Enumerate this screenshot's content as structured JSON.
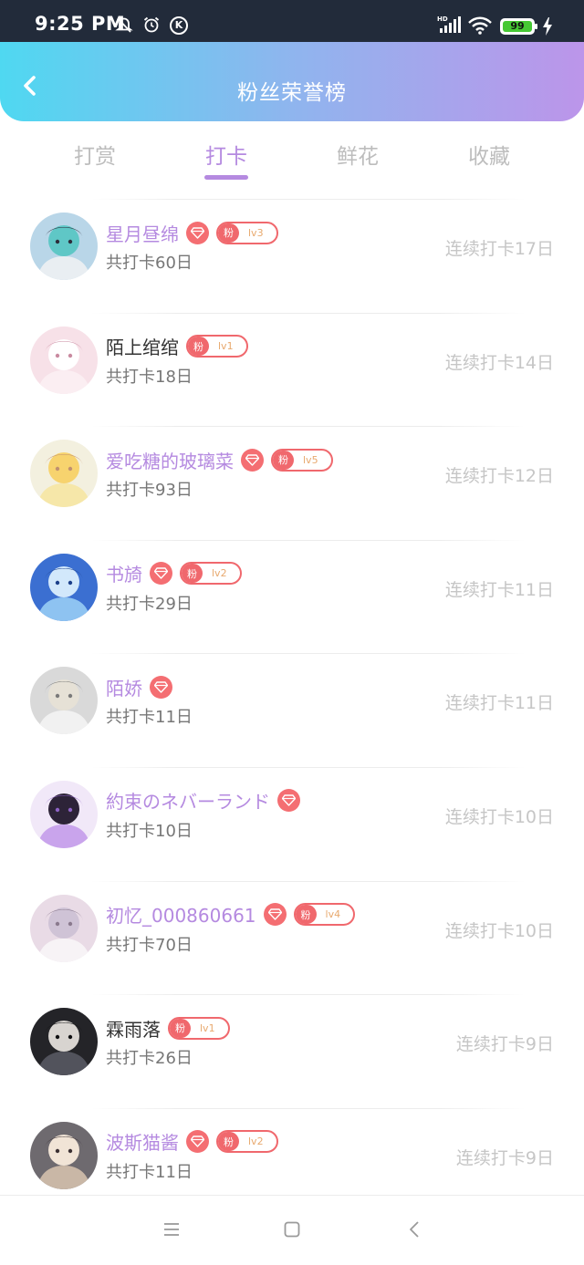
{
  "status_bar": {
    "time": "9:25 PM",
    "k_badge": "K",
    "network": "HD",
    "battery": "99"
  },
  "header": {
    "title": "粉丝荣誉榜",
    "back_icon": "chevron-left-icon"
  },
  "tabs": [
    {
      "label": "打赏",
      "active": false
    },
    {
      "label": "打卡",
      "active": true
    },
    {
      "label": "鲜花",
      "active": false
    },
    {
      "label": "收藏",
      "active": false
    }
  ],
  "badge_tag": "粉",
  "fans": [
    {
      "name": "星月昼绵",
      "name_style": "vip",
      "diamond": true,
      "level": "lv3",
      "total": "共打卡60日",
      "streak": "连续打卡17日"
    },
    {
      "name": "陌上绾绾",
      "name_style": "plain",
      "diamond": false,
      "level": "lv1",
      "total": "共打卡18日",
      "streak": "连续打卡14日"
    },
    {
      "name": "爱吃糖的玻璃菜",
      "name_style": "vip",
      "diamond": true,
      "level": "lv5",
      "total": "共打卡93日",
      "streak": "连续打卡12日"
    },
    {
      "name": "书旑",
      "name_style": "vip",
      "diamond": true,
      "level": "lv2",
      "total": "共打卡29日",
      "streak": "连续打卡11日"
    },
    {
      "name": "陌娇",
      "name_style": "vip",
      "diamond": true,
      "level": "",
      "total": "共打卡11日",
      "streak": "连续打卡11日"
    },
    {
      "name": "約束のネバーランド",
      "name_style": "vip",
      "diamond": true,
      "level": "",
      "total": "共打卡10日",
      "streak": "连续打卡10日"
    },
    {
      "name": "初忆_000860661",
      "name_style": "vip",
      "diamond": true,
      "level": "lv4",
      "total": "共打卡70日",
      "streak": "连续打卡10日"
    },
    {
      "name": "霖雨落",
      "name_style": "plain",
      "diamond": false,
      "level": "lv1",
      "total": "共打卡26日",
      "streak": "连续打卡9日"
    },
    {
      "name": "波斯猫酱",
      "name_style": "vip",
      "diamond": true,
      "level": "lv2",
      "total": "共打卡11日",
      "streak": "连续打卡9日"
    }
  ],
  "colors": {
    "accent": "#b58ae0",
    "badge_red": "#f0686d",
    "header_start": "#4fd8f1",
    "header_end": "#bc95ea"
  },
  "nav_bar": {
    "icons": [
      "menu-icon",
      "home-square-icon",
      "back-triangle-icon"
    ]
  }
}
